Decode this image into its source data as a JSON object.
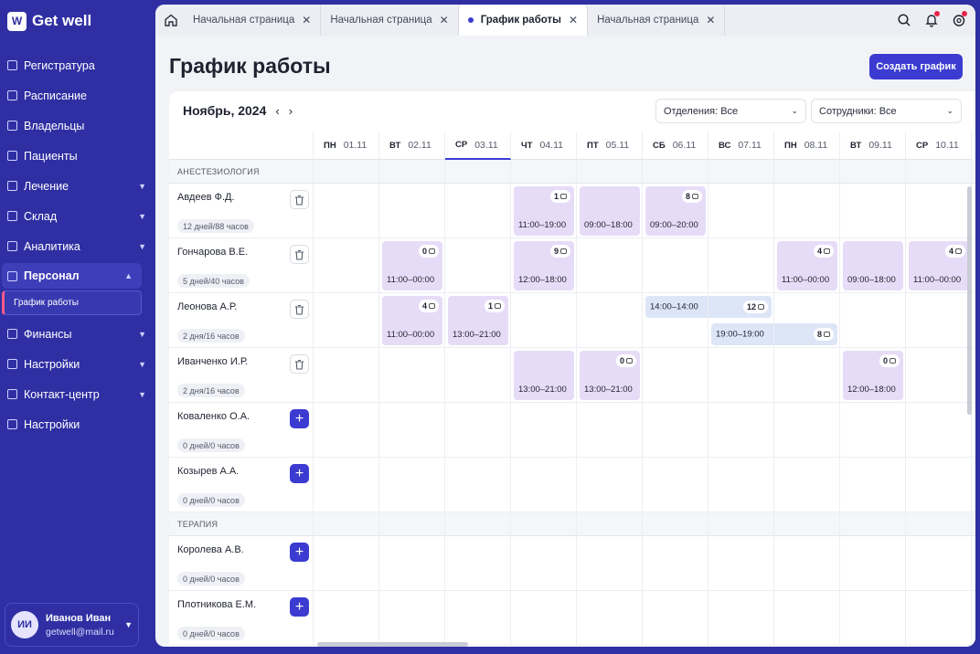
{
  "app": {
    "logo_mark": "W",
    "logo_text": "Get well"
  },
  "sidebar": {
    "items": [
      {
        "label": "Регистратура",
        "icon": "register-icon",
        "chev": false
      },
      {
        "label": "Расписание",
        "icon": "calendar-icon",
        "chev": false
      },
      {
        "label": "Владельцы",
        "icon": "owners-icon",
        "chev": false
      },
      {
        "label": "Пациенты",
        "icon": "paw-icon",
        "chev": false
      },
      {
        "label": "Лечение",
        "icon": "plus-box-icon",
        "chev": true
      },
      {
        "label": "Склад",
        "icon": "box-icon",
        "chev": true
      },
      {
        "label": "Аналитика",
        "icon": "chart-icon",
        "chev": true
      },
      {
        "label": "Персонал",
        "icon": "user-icon",
        "chev": true,
        "active": true
      },
      {
        "label": "Финансы",
        "icon": "finance-icon",
        "chev": true
      },
      {
        "label": "Настройки",
        "icon": "settings-icon",
        "chev": true
      },
      {
        "label": "Контакт-центр",
        "icon": "chat-icon",
        "chev": true
      },
      {
        "label": "Настройки",
        "icon": "gear-icon",
        "chev": false
      }
    ],
    "sub_item": "График работы"
  },
  "user": {
    "initials": "ИИ",
    "name": "Иванов Иван",
    "email": "getwell@mail.ru"
  },
  "tabs": [
    {
      "label": "Начальная страница",
      "active": false
    },
    {
      "label": "Начальная страница",
      "active": false
    },
    {
      "label": "График работы",
      "active": true
    },
    {
      "label": "Начальная страница",
      "active": false
    }
  ],
  "page": {
    "title": "График работы",
    "create_button": "Создать график"
  },
  "toolbar": {
    "month": "Ноябрь, 2024",
    "prev": "‹",
    "next": "›",
    "department_filter": "Отделения: Все",
    "employee_filter": "Сотрудники: Все"
  },
  "days": [
    {
      "dow": "ПН",
      "date": "01.11"
    },
    {
      "dow": "ВТ",
      "date": "02.11"
    },
    {
      "dow": "СР",
      "date": "03.11",
      "today": true
    },
    {
      "dow": "ЧТ",
      "date": "04.11"
    },
    {
      "dow": "ПТ",
      "date": "05.11"
    },
    {
      "dow": "СБ",
      "date": "06.11"
    },
    {
      "dow": "ВС",
      "date": "07.11"
    },
    {
      "dow": "ПН",
      "date": "08.11"
    },
    {
      "dow": "ВТ",
      "date": "09.11"
    },
    {
      "dow": "СР",
      "date": "10.11"
    }
  ],
  "sections": [
    {
      "title": "АНЕСТЕЗИОЛОГИЯ",
      "employees": [
        {
          "name": "Авдеев Ф.Д.",
          "summary": "12 дней/88 часов",
          "action": "delete",
          "shifts": [
            {
              "day": 3,
              "time": "11:00–19:00",
              "comments": "1",
              "color": "purple"
            },
            {
              "day": 4,
              "time": "09:00–18:00",
              "color": "purple"
            },
            {
              "day": 5,
              "time": "09:00–20:00",
              "comments": "8",
              "color": "purple"
            }
          ]
        },
        {
          "name": "Гончарова В.Е.",
          "summary": "5 дней/40 часов",
          "action": "delete",
          "shifts": [
            {
              "day": 1,
              "time": "11:00–00:00",
              "comments": "0",
              "color": "purple"
            },
            {
              "day": 3,
              "time": "12:00–18:00",
              "comments": "9",
              "color": "purple"
            },
            {
              "day": 7,
              "time": "11:00–00:00",
              "comments": "4",
              "color": "purple"
            },
            {
              "day": 8,
              "time": "09:00–18:00",
              "color": "purple"
            },
            {
              "day": 9,
              "time": "11:00–00:00",
              "comments": "4",
              "color": "purple"
            }
          ]
        },
        {
          "name": "Леонова А.Р.",
          "summary": "2 дня/16 часов",
          "action": "delete",
          "shifts": [
            {
              "day": 1,
              "time": "11:00–00:00",
              "comments": "4",
              "color": "purple"
            },
            {
              "day": 2,
              "time": "13:00–21:00",
              "comments": "1",
              "color": "purple"
            },
            {
              "day": 5,
              "span": 2,
              "lane": 0,
              "time": "14:00–14:00",
              "comments": "12",
              "color": "blue"
            },
            {
              "day": 6,
              "span": 2,
              "lane": 1,
              "time": "19:00–19:00",
              "comments": "8",
              "color": "blue"
            }
          ]
        },
        {
          "name": "Иванченко И.Р.",
          "summary": "2 дня/16 часов",
          "action": "delete",
          "shifts": [
            {
              "day": 3,
              "time": "13:00–21:00",
              "color": "purple"
            },
            {
              "day": 4,
              "time": "13:00–21:00",
              "comments": "0",
              "color": "purple"
            },
            {
              "day": 8,
              "time": "12:00–18:00",
              "comments": "0",
              "color": "purple"
            }
          ]
        },
        {
          "name": "Коваленко О.А.",
          "summary": "0 дней/0 часов",
          "action": "add",
          "shifts": []
        },
        {
          "name": "Козырев А.А.",
          "summary": "0 дней/0 часов",
          "action": "add",
          "shifts": []
        }
      ]
    },
    {
      "title": "ТЕРАПИЯ",
      "employees": [
        {
          "name": "Королева А.В.",
          "summary": "0 дней/0 часов",
          "action": "add",
          "shifts": []
        },
        {
          "name": "Плотникова Е.М.",
          "summary": "0 дней/0 часов",
          "action": "add",
          "shifts": []
        }
      ]
    }
  ],
  "colors": {
    "accent": "#3b3bd1",
    "sidebar": "#2f2fa3",
    "shift_purple": "#e7dcf7",
    "shift_blue": "#dde6f7"
  }
}
